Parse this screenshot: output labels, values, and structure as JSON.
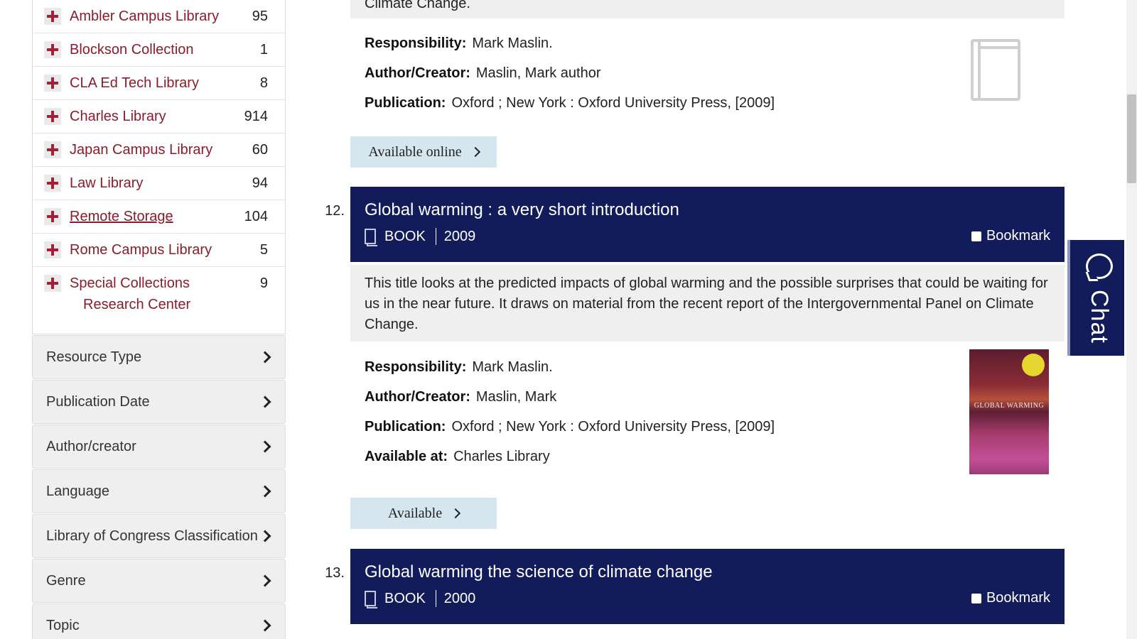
{
  "sidebar": {
    "libraries": [
      {
        "name": "Ambler Campus Library",
        "count": "95"
      },
      {
        "name": "Blockson Collection",
        "count": "1"
      },
      {
        "name": "CLA Ed Tech Library",
        "count": "8"
      },
      {
        "name": "Charles Library",
        "count": "914"
      },
      {
        "name": "Japan Campus Library",
        "count": "60"
      },
      {
        "name": "Law Library",
        "count": "94"
      },
      {
        "name": "Remote Storage",
        "count": "104"
      },
      {
        "name": "Rome Campus Library",
        "count": "5"
      },
      {
        "name_line1": "Special Collections",
        "name_line2": "Research Center",
        "count": "9"
      }
    ],
    "facets": [
      "Resource Type",
      "Publication Date",
      "Author/creator",
      "Language",
      "Library of Congress Classification",
      "Genre",
      "Topic"
    ]
  },
  "results": {
    "prev": {
      "summary_tail": "Climate Change.",
      "responsibility_label": "Responsibility:",
      "responsibility": "Mark Maslin.",
      "author_label": "Author/Creator:",
      "author": "Maslin, Mark author",
      "publication_label": "Publication:",
      "publication": "Oxford ; New York : Oxford University Press, [2009]",
      "button": "Available online"
    },
    "r12": {
      "number": "12.",
      "title": "Global warming : a very short introduction",
      "type": "BOOK",
      "year": "2009",
      "bookmark": "Bookmark",
      "summary": "This title looks at the predicted impacts of global warming and the possible surprises that could be waiting for us in the near future. It draws on material from the recent report of the Intergovernmental Panel on Climate Change.",
      "responsibility_label": "Responsibility:",
      "responsibility": "Mark Maslin.",
      "author_label": "Author/Creator:",
      "author": "Maslin, Mark",
      "publication_label": "Publication:",
      "publication": "Oxford ; New York : Oxford University Press, [2009]",
      "available_label": "Available at:",
      "available": "Charles Library",
      "cover_text": "GLOBAL WARMING",
      "button": "Available"
    },
    "r13": {
      "number": "13.",
      "title": "Global warming the science of climate change",
      "type": "BOOK",
      "year": "2000",
      "bookmark": "Bookmark"
    }
  },
  "chat": {
    "label": "Chat"
  },
  "colors": {
    "navy": "#131c5a",
    "crimson": "#a41e35",
    "link": "#8b1c2c",
    "button_bg": "#d6e6ef"
  }
}
